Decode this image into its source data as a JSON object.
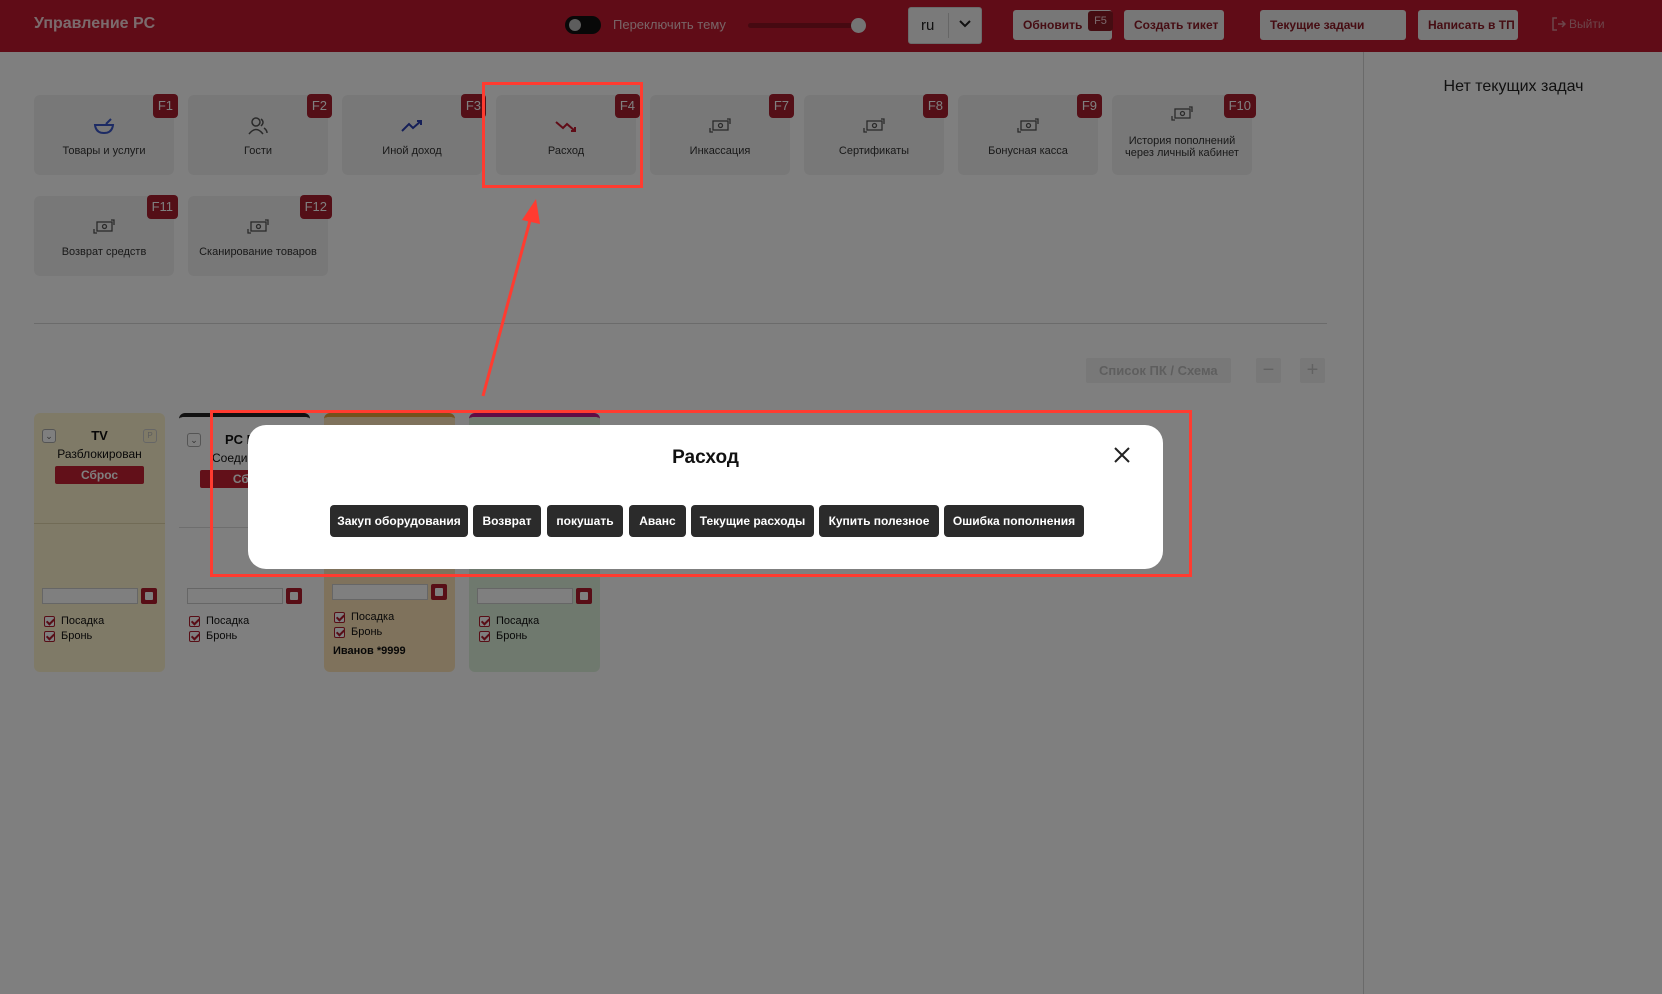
{
  "header": {
    "app_title": "Управление PC",
    "theme_label": "Переключить тему",
    "language": "ru",
    "refresh_label": "Обновить",
    "refresh_key": "F5",
    "create_ticket_label": "Создать тикет",
    "current_tasks_label": "Текущие задачи",
    "write_support_label": "Написать в ТП",
    "logout_label": "Выйти",
    "brand_color": "#c0192e"
  },
  "right_panel": {
    "empty_text": "Нет текущих задач"
  },
  "tiles": [
    {
      "label": "Товары и услуги",
      "key": "F1",
      "icon": "bowl-icon"
    },
    {
      "label": "Гости",
      "key": "F2",
      "icon": "guests-icon"
    },
    {
      "label": "Иной доход",
      "key": "F3",
      "icon": "trend-up-icon"
    },
    {
      "label": "Расход",
      "key": "F4",
      "icon": "trend-down-icon"
    },
    {
      "label": "Инкассация",
      "key": "F7",
      "icon": "cash-exchange-icon"
    },
    {
      "label": "Сертификаты",
      "key": "F8",
      "icon": "cash-exchange-icon"
    },
    {
      "label": "Бонусная касса",
      "key": "F9",
      "icon": "cash-exchange-icon"
    },
    {
      "label": "История пополнений через личный кабинет",
      "key": "F10",
      "icon": "cash-exchange-icon"
    },
    {
      "label": "Возврат средств",
      "key": "F11",
      "icon": "cash-exchange-icon"
    },
    {
      "label": "Сканирование товаров",
      "key": "F12",
      "icon": "cash-exchange-icon"
    }
  ],
  "pc_controls": {
    "list_scheme_label": "Список ПК / Схема",
    "minus": "−",
    "plus": "+"
  },
  "pc_cards": [
    {
      "name": "TV",
      "status": "Разблокирован",
      "reset": "Сброс",
      "seat_label": "Посадка",
      "booking_label": "Бронь",
      "user": ""
    },
    {
      "name": "PC П",
      "status": "Соеди",
      "reset": "Сбр",
      "seat_label": "Посадка",
      "booking_label": "Бронь",
      "user": ""
    },
    {
      "name": "",
      "status": "",
      "reset": "",
      "seat_label": "Посадка",
      "booking_label": "Бронь",
      "user": "Иванов *9999"
    },
    {
      "name": "",
      "status": "",
      "reset": "",
      "seat_label": "Посадка",
      "booking_label": "Бронь",
      "user": ""
    }
  ],
  "modal": {
    "title": "Расход",
    "categories": [
      "Закуп оборудования",
      "Возврат",
      "покушать",
      "Аванс",
      "Текущие расходы",
      "Купить полезное",
      "Ошибка пополнения"
    ]
  }
}
